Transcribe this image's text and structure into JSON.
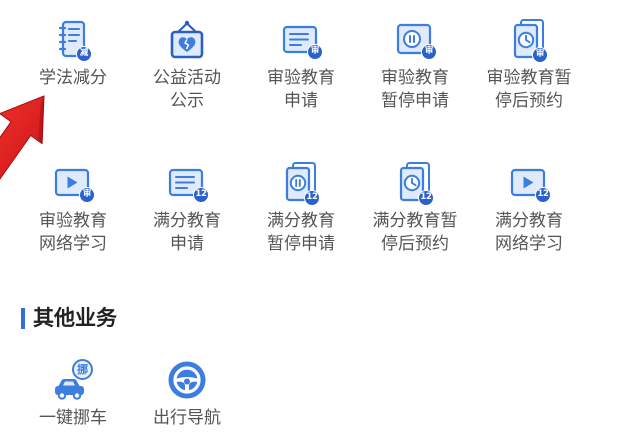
{
  "colors": {
    "icon_stroke": "#3c7ddf",
    "icon_fill_light": "#dfeafb",
    "badge_fill": "#2a62c9",
    "label_text": "#555555",
    "heading_text": "#222222",
    "section_bar": "#2f6fd8",
    "background": "#ffffff"
  },
  "services": {
    "row1": [
      {
        "icon": "notebook-icon",
        "badge": "减",
        "lines": [
          "学法减分"
        ]
      },
      {
        "icon": "hanging-heart-sign-icon",
        "lines": [
          "公益活动",
          "公示"
        ]
      },
      {
        "icon": "document-lines-icon",
        "badge": "审",
        "lines": [
          "审验教育",
          "申请"
        ]
      },
      {
        "icon": "pause-card-icon",
        "badge": "审",
        "lines": [
          "审验教育",
          "暂停申请"
        ]
      },
      {
        "icon": "stacked-clock-document-icon",
        "badge": "审",
        "lines": [
          "审验教育暂",
          "停后预约"
        ]
      }
    ],
    "row2": [
      {
        "icon": "video-play-icon",
        "badge": "审",
        "lines": [
          "审验教育",
          "网络学习"
        ]
      },
      {
        "icon": "document-lines-icon",
        "badge": "12",
        "lines": [
          "满分教育",
          "申请"
        ]
      },
      {
        "icon": "stacked-pause-document-icon",
        "badge": "12",
        "lines": [
          "满分教育",
          "暂停申请"
        ]
      },
      {
        "icon": "stacked-clock-document-icon",
        "badge": "12",
        "lines": [
          "满分教育暂",
          "停后预约"
        ]
      },
      {
        "icon": "video-play-icon",
        "badge": "12",
        "lines": [
          "满分教育",
          "网络学习"
        ]
      }
    ]
  },
  "other_section": {
    "title": "其他业务",
    "items": [
      {
        "icon": "car-move-icon",
        "badge": "挪",
        "lines": [
          "一键挪车"
        ]
      },
      {
        "icon": "steering-wheel-icon",
        "lines": [
          "出行导航"
        ]
      }
    ]
  },
  "annotation_arrow": {
    "icon": "red-arrow-icon",
    "color": "#e3151b"
  }
}
